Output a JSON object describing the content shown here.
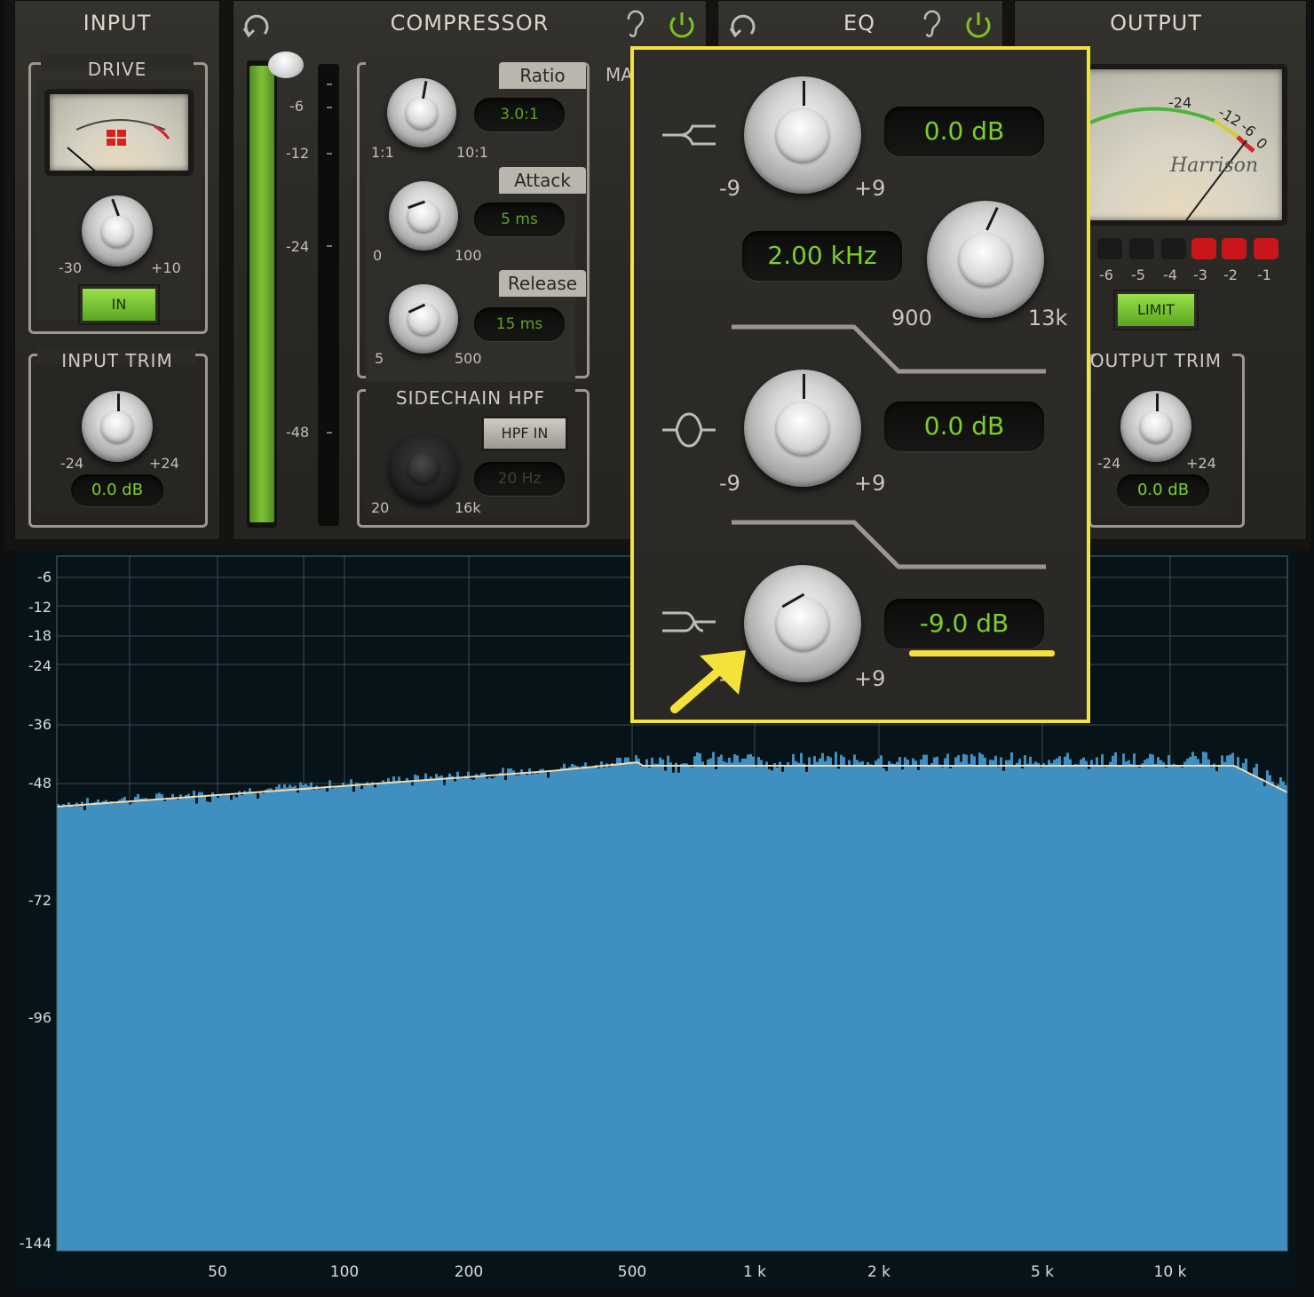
{
  "input": {
    "title": "INPUT",
    "drive_label": "DRIVE",
    "drive_min": "-30",
    "drive_max": "+10",
    "in_button": "IN",
    "trim_label": "INPUT TRIM",
    "trim_min": "-24",
    "trim_max": "+24",
    "trim_value": "0.0 dB"
  },
  "compressor": {
    "title": "COMPRESSOR",
    "meter_scale": [
      "-6",
      "-12",
      "-24",
      "-48"
    ],
    "ratio": {
      "label": "Ratio",
      "value": "3.0:1",
      "min": "1:1",
      "max": "10:1"
    },
    "attack": {
      "label": "Attack",
      "value": "5 ms",
      "min": "0",
      "max": "100"
    },
    "release": {
      "label": "Release",
      "value": "15 ms",
      "min": "5",
      "max": "500"
    },
    "sidechain": {
      "label": "SIDECHAIN HPF",
      "button": "HPF IN",
      "value": "20 Hz",
      "min": "20",
      "max": "16k"
    },
    "hidden_partial": "MA"
  },
  "eq": {
    "title": "EQ",
    "low": {
      "value": "0.0 dB",
      "min": "-9",
      "max": "+9"
    },
    "freq": {
      "value": "2.00 kHz",
      "min": "900",
      "max": "13k"
    },
    "mid": {
      "value": "0.0 dB",
      "min": "-9",
      "max": "+9"
    },
    "high": {
      "value": "-9.0 dB",
      "min": "-9",
      "max": "+9"
    }
  },
  "output": {
    "title": "OUTPUT",
    "meter_ticks": [
      "-24",
      "-12",
      "-6",
      "0"
    ],
    "brand": "Harrison",
    "led_labels": [
      "-6",
      "-5",
      "-4",
      "-3",
      "-2",
      "-1"
    ],
    "limit_button": "LIMIT",
    "trim_label": "OUTPUT TRIM",
    "trim_min": "-24",
    "trim_max": "+24",
    "trim_value": "0.0 dB"
  },
  "analyzer": {
    "y_labels": [
      "-6",
      "-12",
      "-18",
      "-24",
      "-36",
      "-48",
      "-72",
      "-96",
      "-144"
    ],
    "x_labels": [
      "50",
      "100",
      "200",
      "500",
      "1 k",
      "2 k",
      "5 k",
      "10 k"
    ]
  },
  "colors": {
    "lcd_green": "#7ccf2a",
    "highlight_yellow": "#f4e13a",
    "spectrum_blue": "#3f8fc0"
  }
}
